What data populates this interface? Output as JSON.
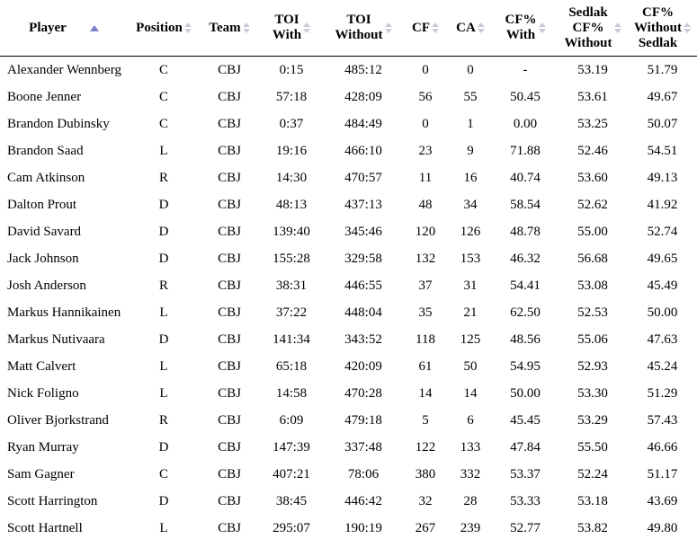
{
  "table": {
    "sort": {
      "active_column": "Player",
      "direction": "ascending",
      "active_icon": "sort-ascending-icon",
      "inactive_icon": "sort-both-icon",
      "active_color": "#7b82c9",
      "inactive_color": "#c8ccd4"
    },
    "columns": [
      {
        "key": "player",
        "lines": [
          "Player"
        ],
        "sorted": true
      },
      {
        "key": "position",
        "lines": [
          "Position"
        ],
        "sorted": false
      },
      {
        "key": "team",
        "lines": [
          "Team"
        ],
        "sorted": false
      },
      {
        "key": "toi_with",
        "lines": [
          "TOI",
          "With"
        ],
        "sorted": false
      },
      {
        "key": "toi_without",
        "lines": [
          "TOI",
          "Without"
        ],
        "sorted": false
      },
      {
        "key": "cf",
        "lines": [
          "CF"
        ],
        "sorted": false
      },
      {
        "key": "ca",
        "lines": [
          "CA"
        ],
        "sorted": false
      },
      {
        "key": "cf_pct_with",
        "lines": [
          "CF%",
          "With"
        ],
        "sorted": false
      },
      {
        "key": "sedlak_cf_pct_without",
        "lines": [
          "Sedlak",
          "CF%",
          "Without"
        ],
        "sorted": false
      },
      {
        "key": "cf_pct_without_sedlak",
        "lines": [
          "CF%",
          "Without",
          "Sedlak"
        ],
        "sorted": false
      }
    ],
    "rows": [
      {
        "player": "Alexander Wennberg",
        "position": "C",
        "team": "CBJ",
        "toi_with": "0:15",
        "toi_without": "485:12",
        "cf": "0",
        "ca": "0",
        "cf_pct_with": "-",
        "sedlak_cf_pct_without": "53.19",
        "cf_pct_without_sedlak": "51.79"
      },
      {
        "player": "Boone Jenner",
        "position": "C",
        "team": "CBJ",
        "toi_with": "57:18",
        "toi_without": "428:09",
        "cf": "56",
        "ca": "55",
        "cf_pct_with": "50.45",
        "sedlak_cf_pct_without": "53.61",
        "cf_pct_without_sedlak": "49.67"
      },
      {
        "player": "Brandon Dubinsky",
        "position": "C",
        "team": "CBJ",
        "toi_with": "0:37",
        "toi_without": "484:49",
        "cf": "0",
        "ca": "1",
        "cf_pct_with": "0.00",
        "sedlak_cf_pct_without": "53.25",
        "cf_pct_without_sedlak": "50.07"
      },
      {
        "player": "Brandon Saad",
        "position": "L",
        "team": "CBJ",
        "toi_with": "19:16",
        "toi_without": "466:10",
        "cf": "23",
        "ca": "9",
        "cf_pct_with": "71.88",
        "sedlak_cf_pct_without": "52.46",
        "cf_pct_without_sedlak": "54.51"
      },
      {
        "player": "Cam Atkinson",
        "position": "R",
        "team": "CBJ",
        "toi_with": "14:30",
        "toi_without": "470:57",
        "cf": "11",
        "ca": "16",
        "cf_pct_with": "40.74",
        "sedlak_cf_pct_without": "53.60",
        "cf_pct_without_sedlak": "49.13"
      },
      {
        "player": "Dalton Prout",
        "position": "D",
        "team": "CBJ",
        "toi_with": "48:13",
        "toi_without": "437:13",
        "cf": "48",
        "ca": "34",
        "cf_pct_with": "58.54",
        "sedlak_cf_pct_without": "52.62",
        "cf_pct_without_sedlak": "41.92"
      },
      {
        "player": "David Savard",
        "position": "D",
        "team": "CBJ",
        "toi_with": "139:40",
        "toi_without": "345:46",
        "cf": "120",
        "ca": "126",
        "cf_pct_with": "48.78",
        "sedlak_cf_pct_without": "55.00",
        "cf_pct_without_sedlak": "52.74"
      },
      {
        "player": "Jack Johnson",
        "position": "D",
        "team": "CBJ",
        "toi_with": "155:28",
        "toi_without": "329:58",
        "cf": "132",
        "ca": "153",
        "cf_pct_with": "46.32",
        "sedlak_cf_pct_without": "56.68",
        "cf_pct_without_sedlak": "49.65"
      },
      {
        "player": "Josh Anderson",
        "position": "R",
        "team": "CBJ",
        "toi_with": "38:31",
        "toi_without": "446:55",
        "cf": "37",
        "ca": "31",
        "cf_pct_with": "54.41",
        "sedlak_cf_pct_without": "53.08",
        "cf_pct_without_sedlak": "45.49"
      },
      {
        "player": "Markus Hannikainen",
        "position": "L",
        "team": "CBJ",
        "toi_with": "37:22",
        "toi_without": "448:04",
        "cf": "35",
        "ca": "21",
        "cf_pct_with": "62.50",
        "sedlak_cf_pct_without": "52.53",
        "cf_pct_without_sedlak": "50.00"
      },
      {
        "player": "Markus Nutivaara",
        "position": "D",
        "team": "CBJ",
        "toi_with": "141:34",
        "toi_without": "343:52",
        "cf": "118",
        "ca": "125",
        "cf_pct_with": "48.56",
        "sedlak_cf_pct_without": "55.06",
        "cf_pct_without_sedlak": "47.63"
      },
      {
        "player": "Matt Calvert",
        "position": "L",
        "team": "CBJ",
        "toi_with": "65:18",
        "toi_without": "420:09",
        "cf": "61",
        "ca": "50",
        "cf_pct_with": "54.95",
        "sedlak_cf_pct_without": "52.93",
        "cf_pct_without_sedlak": "45.24"
      },
      {
        "player": "Nick Foligno",
        "position": "L",
        "team": "CBJ",
        "toi_with": "14:58",
        "toi_without": "470:28",
        "cf": "14",
        "ca": "14",
        "cf_pct_with": "50.00",
        "sedlak_cf_pct_without": "53.30",
        "cf_pct_without_sedlak": "51.29"
      },
      {
        "player": "Oliver Bjorkstrand",
        "position": "R",
        "team": "CBJ",
        "toi_with": "6:09",
        "toi_without": "479:18",
        "cf": "5",
        "ca": "6",
        "cf_pct_with": "45.45",
        "sedlak_cf_pct_without": "53.29",
        "cf_pct_without_sedlak": "57.43"
      },
      {
        "player": "Ryan Murray",
        "position": "D",
        "team": "CBJ",
        "toi_with": "147:39",
        "toi_without": "337:48",
        "cf": "122",
        "ca": "133",
        "cf_pct_with": "47.84",
        "sedlak_cf_pct_without": "55.50",
        "cf_pct_without_sedlak": "46.66"
      },
      {
        "player": "Sam Gagner",
        "position": "C",
        "team": "CBJ",
        "toi_with": "407:21",
        "toi_without": "78:06",
        "cf": "380",
        "ca": "332",
        "cf_pct_with": "53.37",
        "sedlak_cf_pct_without": "52.24",
        "cf_pct_without_sedlak": "51.17"
      },
      {
        "player": "Scott Harrington",
        "position": "D",
        "team": "CBJ",
        "toi_with": "38:45",
        "toi_without": "446:42",
        "cf": "32",
        "ca": "28",
        "cf_pct_with": "53.33",
        "sedlak_cf_pct_without": "53.18",
        "cf_pct_without_sedlak": "43.69"
      },
      {
        "player": "Scott Hartnell",
        "position": "L",
        "team": "CBJ",
        "toi_with": "295:07",
        "toi_without": "190:19",
        "cf": "267",
        "ca": "239",
        "cf_pct_with": "52.77",
        "sedlak_cf_pct_without": "53.82",
        "cf_pct_without_sedlak": "49.80"
      }
    ]
  }
}
